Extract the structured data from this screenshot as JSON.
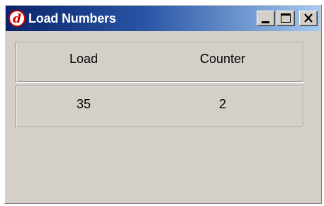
{
  "window": {
    "title": "Load Numbers",
    "icon": "red-d-logo-icon",
    "controls": [
      "minimize",
      "maximize",
      "close"
    ]
  },
  "table": {
    "headers": [
      "Load",
      "Counter"
    ],
    "rows": [
      [
        "35",
        "2"
      ]
    ]
  },
  "colors": {
    "titlebar_start": "#0a246a",
    "titlebar_end": "#a6caf0",
    "window_bg": "#d4d0c8",
    "icon_red": "#cc0000"
  }
}
